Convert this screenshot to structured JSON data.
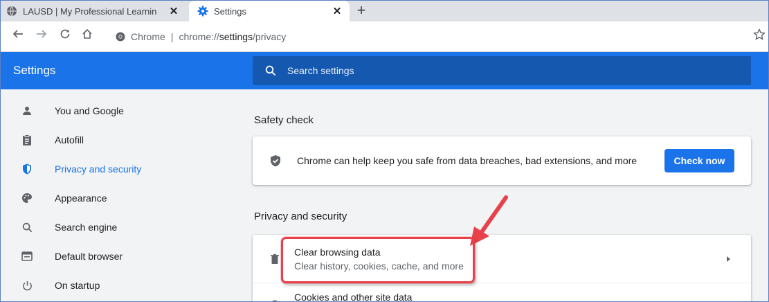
{
  "browser": {
    "tabs": [
      {
        "label": "LAUSD | My Professional Learnin",
        "icon": "globe-icon",
        "active": false
      },
      {
        "label": "Settings",
        "icon": "gear-icon",
        "active": true
      }
    ],
    "new_tab_symbol": "+",
    "close_symbol": "✕",
    "omnibox": {
      "site_label": "Chrome",
      "separator": "|",
      "url_prefix": "chrome://",
      "url_main": "settings",
      "url_suffix": "/privacy"
    }
  },
  "header": {
    "title": "Settings",
    "search_placeholder": "Search settings"
  },
  "sidebar": {
    "items": [
      {
        "label": "You and Google",
        "icon": "person-icon",
        "selected": false
      },
      {
        "label": "Autofill",
        "icon": "clipboard-icon",
        "selected": false
      },
      {
        "label": "Privacy and security",
        "icon": "shield-icon",
        "selected": true
      },
      {
        "label": "Appearance",
        "icon": "palette-icon",
        "selected": false
      },
      {
        "label": "Search engine",
        "icon": "search-icon",
        "selected": false
      },
      {
        "label": "Default browser",
        "icon": "browser-window-icon",
        "selected": false
      },
      {
        "label": "On startup",
        "icon": "power-icon",
        "selected": false
      }
    ]
  },
  "main": {
    "safety_check": {
      "title": "Safety check",
      "description": "Chrome can help keep you safe from data breaches, bad extensions, and more",
      "button_label": "Check now"
    },
    "privacy": {
      "title": "Privacy and security",
      "rows": [
        {
          "title": "Clear browsing data",
          "subtitle": "Clear history, cookies, cache, and more",
          "icon": "trash-icon"
        },
        {
          "title": "Cookies and other site data",
          "subtitle": "",
          "icon": "cookie-icon"
        }
      ]
    }
  },
  "colors": {
    "accent": "#1a73e8",
    "header_bg": "#1a73e8",
    "search_bg": "#1558b0",
    "annotation": "#e8414b",
    "page_bg": "#f1f3f4"
  }
}
